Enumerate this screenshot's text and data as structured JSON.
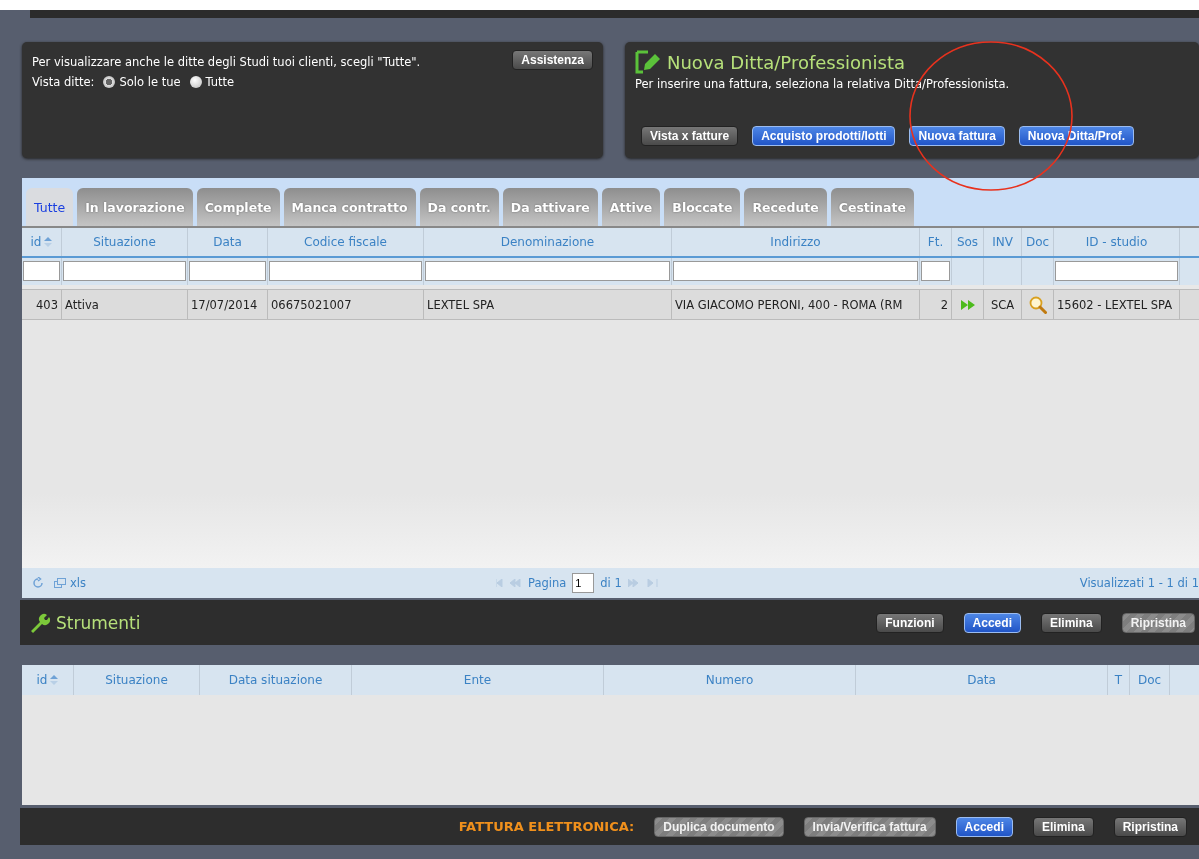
{
  "info_panel": {
    "text": "Per visualizzare anche le ditte degli Studi tuoi clienti, scegli \"Tutte\".",
    "assist_button": "Assistenza",
    "view_label": "Vista ditte:",
    "radios": [
      {
        "label": "Solo le tue",
        "selected": true
      },
      {
        "label": "Tutte",
        "selected": false
      }
    ]
  },
  "new_panel": {
    "title": "Nuova Ditta/Professionista",
    "text": "Per inserire una fattura, seleziona la relativa Ditta/Professionista.",
    "buttons": [
      {
        "label": "Vista x fatture",
        "kind": "dark",
        "disabled": false
      },
      {
        "label": "Acquisto prodotti/lotti",
        "kind": "blue",
        "disabled": false
      },
      {
        "label": "Nuova fattura",
        "kind": "blue",
        "disabled": false
      },
      {
        "label": "Nuova Ditta/Prof.",
        "kind": "blue",
        "disabled": false
      }
    ]
  },
  "annotations": [
    {
      "kind": "circle"
    }
  ],
  "tabs": [
    {
      "label": "Tutte",
      "selected": true
    },
    {
      "label": "In lavorazione",
      "selected": false
    },
    {
      "label": "Complete",
      "selected": false
    },
    {
      "label": "Manca contratto",
      "selected": false
    },
    {
      "label": "Da contr.",
      "selected": false
    },
    {
      "label": "Da attivare",
      "selected": false
    },
    {
      "label": "Attive",
      "selected": false
    },
    {
      "label": "Bloccate",
      "selected": false
    },
    {
      "label": "Recedute",
      "selected": false
    },
    {
      "label": "Cestinate",
      "selected": false
    }
  ],
  "grid": {
    "columns": [
      {
        "label": "id",
        "kind": "number",
        "sorted": true,
        "filter": true
      },
      {
        "label": "Situazione",
        "kind": "text",
        "sorted": false,
        "filter": true
      },
      {
        "label": "Data",
        "kind": "text",
        "sorted": false,
        "filter": true
      },
      {
        "label": "Codice fiscale",
        "kind": "text",
        "sorted": false,
        "filter": true
      },
      {
        "label": "Denominazione",
        "kind": "text",
        "sorted": false,
        "filter": true
      },
      {
        "label": "Indirizzo",
        "kind": "text",
        "sorted": false,
        "filter": true
      },
      {
        "label": "Ft.",
        "kind": "number",
        "sorted": false,
        "filter": true
      },
      {
        "label": "Sos",
        "kind": "forward",
        "sorted": false,
        "filter": false
      },
      {
        "label": "INV",
        "kind": "center",
        "sorted": false,
        "filter": false
      },
      {
        "label": "Doc",
        "kind": "magnifier",
        "sorted": false,
        "filter": false
      },
      {
        "label": "ID - studio",
        "kind": "text",
        "sorted": false,
        "filter": true
      }
    ],
    "rows": [
      {
        "cells": [
          "403",
          "Attiva",
          "17/07/2014",
          "06675021007",
          "LEXTEL SPA",
          "VIA GIACOMO PERONI, 400 - ROMA (RM",
          "2",
          "",
          "SCA",
          "",
          "15602 - LEXTEL SPA"
        ]
      }
    ]
  },
  "pager": {
    "export_label": "xls",
    "page_label": "Pagina",
    "page_value": "1",
    "page_total": "di 1",
    "status": "Visualizzati 1 - 1 di 1"
  },
  "tools": {
    "title": "Strumenti",
    "buttons": [
      {
        "label": "Funzioni",
        "kind": "dark",
        "disabled": false
      },
      {
        "label": "Accedi",
        "kind": "blue",
        "disabled": false
      },
      {
        "label": "Elimina",
        "kind": "dark",
        "disabled": false
      },
      {
        "label": "Ripristina",
        "kind": "dark",
        "disabled": true
      }
    ]
  },
  "grid2": {
    "columns": [
      {
        "label": "id",
        "sorted": true
      },
      {
        "label": "Situazione",
        "sorted": false
      },
      {
        "label": "Data situazione",
        "sorted": false
      },
      {
        "label": "Ente",
        "sorted": false
      },
      {
        "label": "Numero",
        "sorted": false
      },
      {
        "label": "Data",
        "sorted": false
      },
      {
        "label": "T",
        "sorted": false
      },
      {
        "label": "Doc",
        "sorted": false
      }
    ]
  },
  "footer": {
    "label": "FATTURA ELETTRONICA:",
    "buttons": [
      {
        "label": "Duplica documento",
        "kind": "dark",
        "disabled": true
      },
      {
        "label": "Invia/Verifica fattura",
        "kind": "dark",
        "disabled": true
      },
      {
        "label": "Accedi",
        "kind": "blue",
        "disabled": false
      },
      {
        "label": "Elimina",
        "kind": "dark",
        "disabled": false
      },
      {
        "label": "Ripristina",
        "kind": "dark",
        "disabled": false
      }
    ]
  }
}
